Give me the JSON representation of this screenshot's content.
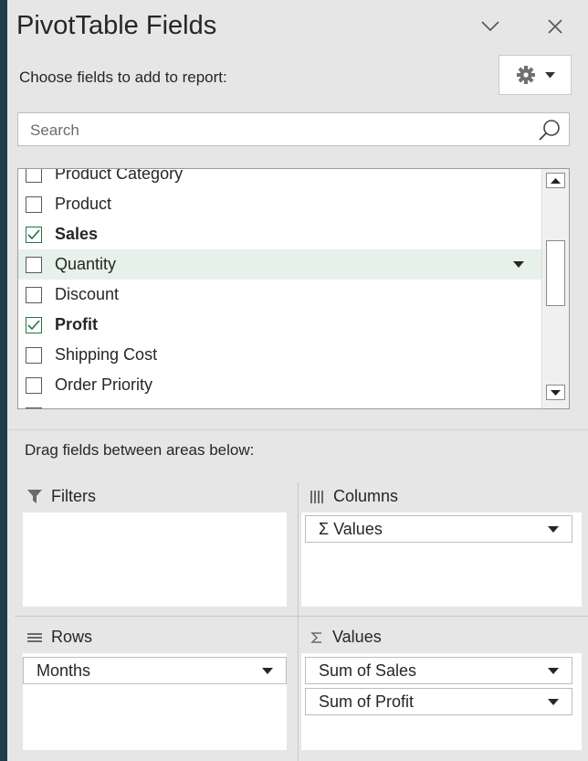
{
  "header": {
    "title": "PivotTable Fields",
    "collapse_icon": "chevron-down-icon",
    "close_icon": "close-icon"
  },
  "choose_label": "Choose fields to add to report:",
  "settings": {
    "icon": "gear-icon",
    "dropdown_icon": "caret-down-icon"
  },
  "search": {
    "placeholder": "Search",
    "value": "",
    "icon": "search-icon"
  },
  "fields": [
    {
      "label": "Product Category",
      "checked": false
    },
    {
      "label": "Product",
      "checked": false
    },
    {
      "label": "Sales",
      "checked": true
    },
    {
      "label": "Quantity",
      "checked": false,
      "hovered": true
    },
    {
      "label": "Discount",
      "checked": false
    },
    {
      "label": "Profit",
      "checked": true
    },
    {
      "label": "Shipping Cost",
      "checked": false
    },
    {
      "label": "Order Priority",
      "checked": false
    }
  ],
  "drag_label": "Drag fields between areas below:",
  "areas": {
    "filters": {
      "label": "Filters",
      "icon": "filter-icon",
      "items": []
    },
    "columns": {
      "label": "Columns",
      "icon": "columns-icon",
      "items": [
        "Σ Values"
      ]
    },
    "rows": {
      "label": "Rows",
      "icon": "rows-icon",
      "items": [
        "Months"
      ]
    },
    "values": {
      "label": "Values",
      "icon": "sigma-icon",
      "items": [
        "Sum of Sales",
        "Sum of Profit"
      ]
    }
  },
  "colors": {
    "accent_green": "#217346",
    "panel_bg": "#e6e6e6",
    "hover_row": "#e5f1ea",
    "window_bg": "#1f3b4c"
  }
}
